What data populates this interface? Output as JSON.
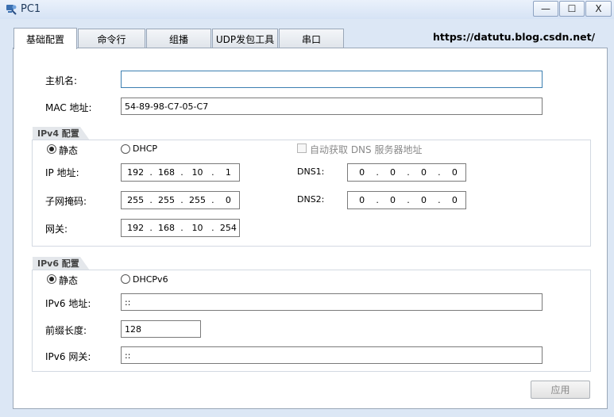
{
  "window": {
    "title": "PC1",
    "minimize_glyph": "—",
    "maximize_glyph": "☐",
    "close_glyph": "X",
    "icon": "pc-app-icon"
  },
  "tabs": [
    {
      "label": "基础配置",
      "active": true
    },
    {
      "label": "命令行",
      "active": false
    },
    {
      "label": "组播",
      "active": false
    },
    {
      "label": "UDP发包工具",
      "active": false
    },
    {
      "label": "串口",
      "active": false
    }
  ],
  "watermark": "https://datutu.blog.csdn.net/",
  "host": {
    "hostname_label": "主机名:",
    "hostname_value": "",
    "mac_label": "MAC 地址:",
    "mac_value": "54-89-98-C7-05-C7"
  },
  "ipv4": {
    "legend": "IPv4 配置",
    "static_label": "静态",
    "dhcp_label": "DHCP",
    "static_selected": true,
    "auto_dns_label": "自动获取 DNS 服务器地址",
    "ip_label": "IP 地址:",
    "ip": [
      "192",
      "168",
      "10",
      "1"
    ],
    "mask_label": "子网掩码:",
    "mask": [
      "255",
      "255",
      "255",
      "0"
    ],
    "gateway_label": "网关:",
    "gateway": [
      "192",
      "168",
      "10",
      "254"
    ],
    "dns1_label": "DNS1:",
    "dns1": [
      "0",
      "0",
      "0",
      "0"
    ],
    "dns2_label": "DNS2:",
    "dns2": [
      "0",
      "0",
      "0",
      "0"
    ],
    "dot": "."
  },
  "ipv6": {
    "legend": "IPv6 配置",
    "static_label": "静态",
    "dhcp_label": "DHCPv6",
    "static_selected": true,
    "addr_label": "IPv6 地址:",
    "addr_value": "::",
    "prefix_label": "前缀长度:",
    "prefix_value": "128",
    "gateway_label": "IPv6 网关:",
    "gateway_value": "::"
  },
  "apply_label": "应用",
  "colors": {
    "window_bg": "#dce7f5",
    "focus_border": "#3c7fb1",
    "disabled_text": "#8a8a8a"
  }
}
